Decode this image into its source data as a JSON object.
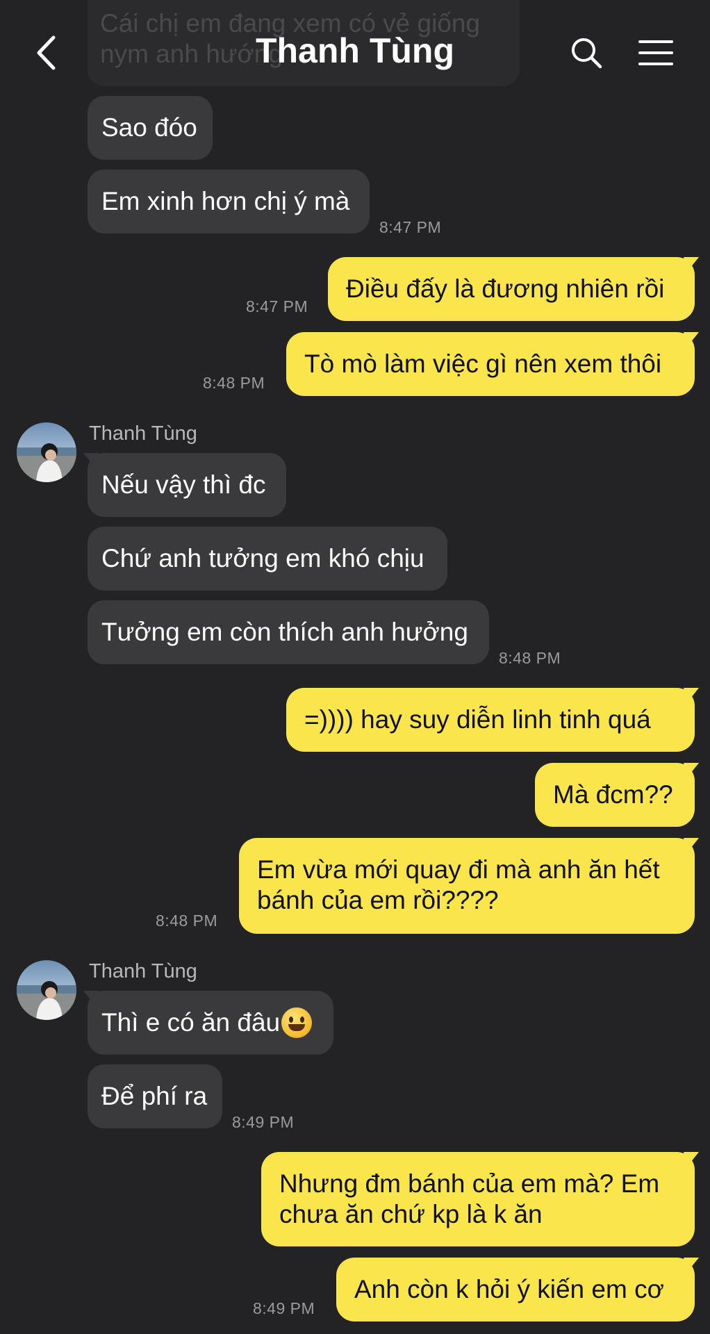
{
  "header": {
    "title": "Thanh Tùng",
    "faded_message": "Cái chị em đang xem có vẻ giống nym anh hướng"
  },
  "messages": {
    "m1": "Sao đóo",
    "m2": "Em xinh hơn chị ý mà",
    "t2": "8:47 PM",
    "m3": "Điều đấy là đương nhiên rồi",
    "t3": "8:47 PM",
    "m4": "Tò mò làm việc gì nên xem thôi",
    "t4": "8:48 PM",
    "sender1": "Thanh Tùng",
    "m5": "Nếu vậy thì đc",
    "m6": "Chứ anh tưởng em khó chịu",
    "m7": "Tưởng em còn thích anh hưởng",
    "t7": "8:48 PM",
    "m8": "=)))) hay suy diễn linh tinh quá",
    "m9": "Mà đcm??",
    "m10": "Em vừa mới quay đi mà anh ăn hết bánh của em rồi????",
    "t10": "8:48 PM",
    "sender2": "Thanh Tùng",
    "m11": "Thì e có ăn đâu",
    "m12": "Để phí ra",
    "t12": "8:49 PM",
    "m13": "Nhưng đm bánh của em mà? Em chưa ăn chứ kp là k ăn",
    "m14": "Anh còn k hỏi ý kiến em cơ",
    "t14": "8:49 PM"
  },
  "icons": {
    "back": "chevron-left-icon",
    "search": "search-icon",
    "menu": "menu-icon",
    "emoji": "grinning-face-emoji"
  },
  "colors": {
    "background": "#232325",
    "incoming_bubble": "#3a3a3c",
    "outgoing_bubble": "#fae54c",
    "timestamp": "#9b9b9e"
  }
}
